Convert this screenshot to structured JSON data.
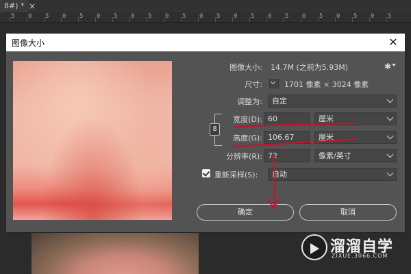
{
  "app": {
    "tab_label": "8#) *",
    "tab_close": "×",
    "ruler_ticks": [
      "5",
      "0",
      "5",
      "0",
      "5",
      "0",
      "5",
      "0",
      "5",
      "0",
      "5",
      "0",
      "5",
      "0",
      "5",
      "0",
      "5",
      "0",
      "5",
      "0",
      "5",
      "0",
      "5"
    ]
  },
  "dialog": {
    "title": "图像大小",
    "close": "✕",
    "image_size_label": "图像大小:",
    "image_size_value": "14.7M (之前为5.93M)",
    "dimensions_label": "尺寸:",
    "dimensions_value": "1701 像素 × 3024 像素",
    "fit_label": "调整为:",
    "fit_value": "自定",
    "width_label": "宽度(D):",
    "width_value": "60",
    "width_unit": "厘米",
    "height_label": "高度(G):",
    "height_value": "106.67",
    "height_unit": "厘米",
    "resolution_label": "分辨率(R):",
    "resolution_value": "72",
    "resolution_unit": "像素/英寸",
    "resample_label": "重新采样(S):",
    "resample_checked": true,
    "resample_value": "自动",
    "ok_label": "确定",
    "cancel_label": "取消",
    "gear_icon": "gear-icon",
    "link_icon": "chain-link-icon"
  },
  "watermark": {
    "title": "溜溜自学",
    "url": "ZIXUE.3066.COM"
  },
  "colors": {
    "dialog_bg": "#535353",
    "field_bg": "#454545",
    "annotation_red": "#c8102e"
  }
}
